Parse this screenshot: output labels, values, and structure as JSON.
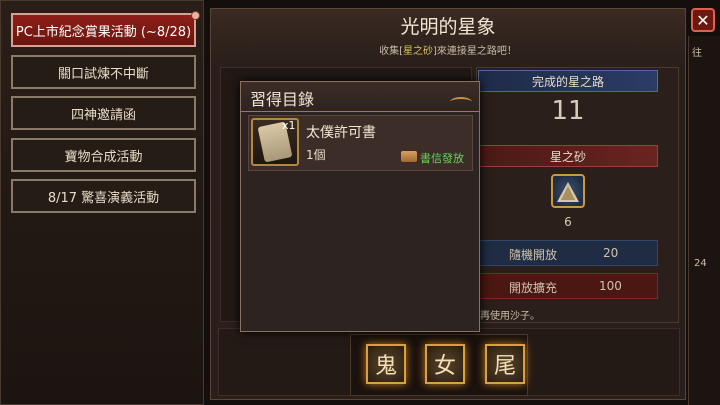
{
  "left_menu": {
    "items": [
      {
        "label": "PC上市紀念賞果活動 (~8/28)",
        "active": true
      },
      {
        "label": "關口試煉不中斷"
      },
      {
        "label": "四神邀請函"
      },
      {
        "label": "寶物合成活動"
      },
      {
        "label": "8/17 驚喜演義活動"
      }
    ]
  },
  "main": {
    "title": "光明的星象",
    "subtitle_pre": "收集[",
    "subtitle_highlight": "星之砂",
    "subtitle_post": "]來連接星之路吧！",
    "complete_label": "完成的星之路",
    "complete_value": "11",
    "sand_label": "星之砂",
    "sand_count": "6",
    "random_open_label": "隨機開放",
    "random_open_value": "20",
    "expand_open_label": "開放擴充",
    "expand_open_value": "100",
    "hint_text": "再使用沙子。",
    "tiles": [
      "鬼",
      "女",
      "尾"
    ]
  },
  "popup": {
    "title": "習得目錄",
    "item": {
      "name": "太僕許可書",
      "quantity_badge": "x1",
      "count": "1個",
      "source": "書信發放"
    }
  },
  "right_edge": {
    "text_top": "往",
    "text_mid": "24"
  },
  "colors": {
    "active_tab": "#8e2018",
    "source_green": "#6ad05a",
    "highlight": "#d9c060"
  }
}
